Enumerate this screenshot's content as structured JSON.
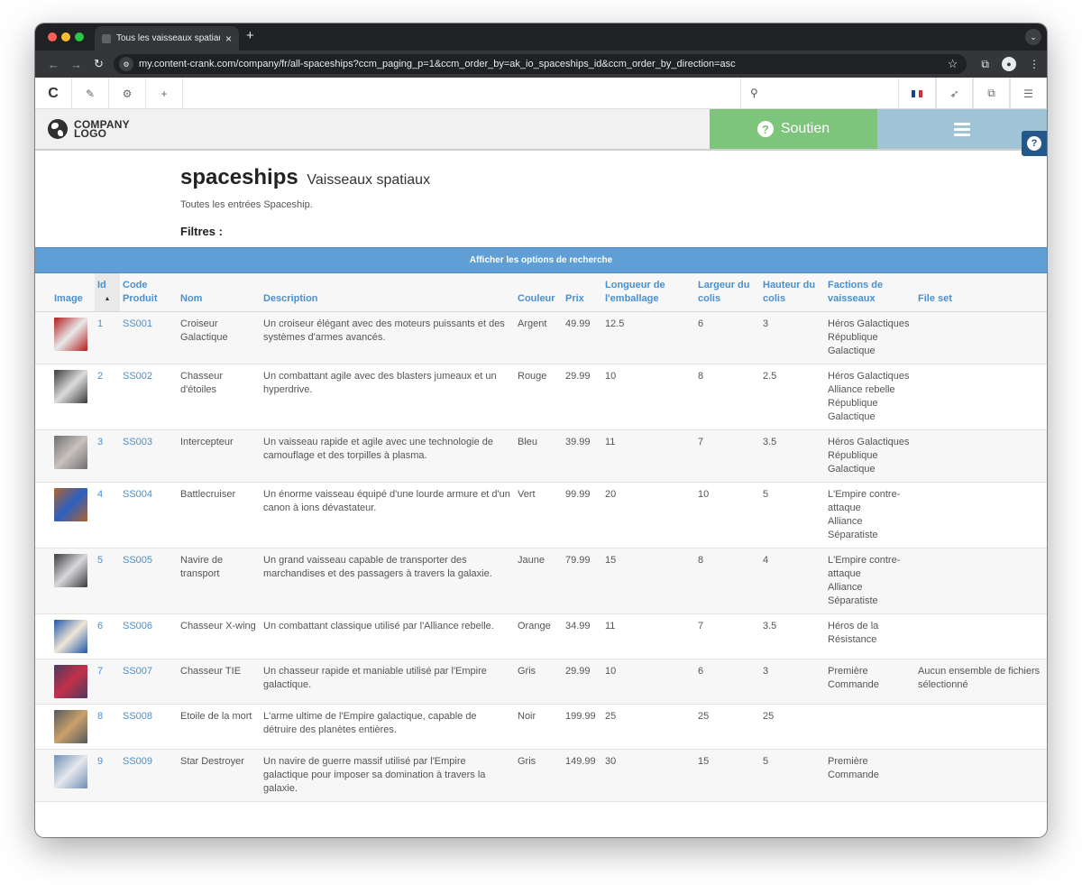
{
  "browser": {
    "tab_title": "Tous les vaisseaux spatiaux :",
    "tab_close": "×",
    "new_tab": "+",
    "url": "my.content-crank.com/company/fr/all-spaceships?ccm_paging_p=1&ccm_order_by=ak_io_spaceships_id&ccm_order_by_direction=asc"
  },
  "cms": {
    "logo": "C"
  },
  "header": {
    "logo_line1": "COMPANY",
    "logo_line2": "LOGO",
    "support_label": "Soutien",
    "help_glyph": "?",
    "support_glyph": "?"
  },
  "page": {
    "title": "spaceships",
    "subtitle": "Vaisseaux spatiaux",
    "description": "Toutes les entrées Spaceship.",
    "filters_label": "Filtres :",
    "search_options_label": "Afficher les options de recherche"
  },
  "colors": {
    "accent": "#4a90d0",
    "support_green": "#7dc57a",
    "menu_blue": "#9fc4d6",
    "search_bar": "#5f9fd6",
    "help": "#24588a"
  },
  "table": {
    "headers": {
      "image": "Image",
      "id": "Id",
      "code": "Code Produit",
      "name": "Nom",
      "description": "Description",
      "color": "Couleur",
      "price": "Prix",
      "pkg_length_1": "Longueur de",
      "pkg_length_2": "l'emballage",
      "width_1": "Largeur du",
      "width_2": "colis",
      "height_1": "Hauteur du",
      "height_2": "colis",
      "factions_1": "Factions de",
      "factions_2": "vaisseaux",
      "fileset": "File set"
    },
    "rows": [
      {
        "id": "1",
        "code": "SS001",
        "name": "Croiseur Galactique",
        "description": "Un croiseur élégant avec des moteurs puissants et des systèmes d'armes avancés.",
        "color": "Argent",
        "price": "49.99",
        "length": "12.5",
        "width": "6",
        "height": "3",
        "factions": [
          "Héros Galactiques",
          "République Galactique"
        ],
        "fileset": "",
        "thumb_colors": [
          "#b11d1d",
          "#e9e9e9"
        ]
      },
      {
        "id": "2",
        "code": "SS002",
        "name": "Chasseur d'étoiles",
        "description": "Un combattant agile avec des blasters jumeaux et un hyperdrive.",
        "color": "Rouge",
        "price": "29.99",
        "length": "10",
        "width": "8",
        "height": "2.5",
        "factions": [
          "Héros Galactiques",
          "Alliance rebelle",
          "République Galactique"
        ],
        "fileset": "",
        "thumb_colors": [
          "#3a3a3a",
          "#dcdcdc"
        ]
      },
      {
        "id": "3",
        "code": "SS003",
        "name": "Intercepteur",
        "description": "Un vaisseau rapide et agile avec une technologie de camouflage et des torpilles à plasma.",
        "color": "Bleu",
        "price": "39.99",
        "length": "11",
        "width": "7",
        "height": "3.5",
        "factions": [
          "Héros Galactiques",
          "République Galactique"
        ],
        "fileset": "",
        "thumb_colors": [
          "#6f6f73",
          "#c9c2bd"
        ]
      },
      {
        "id": "4",
        "code": "SS004",
        "name": "Battlecruiser",
        "description": "Un énorme vaisseau équipé d'une lourde armure et d'un canon à ions dévastateur.",
        "color": "Vert",
        "price": "99.99",
        "length": "20",
        "width": "10",
        "height": "5",
        "factions": [
          "L'Empire contre-attaque",
          "Alliance Séparatiste"
        ],
        "fileset": "",
        "thumb_colors": [
          "#b0642d",
          "#2c5fc0"
        ]
      },
      {
        "id": "5",
        "code": "SS005",
        "name": "Navire de transport",
        "description": "Un grand vaisseau capable de transporter des marchandises et des passagers à travers la galaxie.",
        "color": "Jaune",
        "price": "79.99",
        "length": "15",
        "width": "8",
        "height": "4",
        "factions": [
          "L'Empire contre-attaque",
          "Alliance Séparatiste"
        ],
        "fileset": "",
        "thumb_colors": [
          "#3b3b3e",
          "#d8d8da"
        ]
      },
      {
        "id": "6",
        "code": "SS006",
        "name": "Chasseur X-wing",
        "description": "Un combattant classique utilisé par l'Alliance rebelle.",
        "color": "Orange",
        "price": "34.99",
        "length": "11",
        "width": "7",
        "height": "3.5",
        "factions": [
          "Héros de la Résistance"
        ],
        "fileset": "",
        "thumb_colors": [
          "#1f56a8",
          "#f0e6d8"
        ]
      },
      {
        "id": "7",
        "code": "SS007",
        "name": "Chasseur TIE",
        "description": "Un chasseur rapide et maniable utilisé par l'Empire galactique.",
        "color": "Gris",
        "price": "29.99",
        "length": "10",
        "width": "6",
        "height": "3",
        "factions": [
          "Première Commande"
        ],
        "fileset": "Aucun ensemble de fichiers sélectionné",
        "thumb_colors": [
          "#4a3b5e",
          "#c4304a"
        ]
      },
      {
        "id": "8",
        "code": "SS008",
        "name": "Etoile de la mort",
        "description": "L'arme ultime de l'Empire galactique, capable de détruire des planètes entières.",
        "color": "Noir",
        "price": "199.99",
        "length": "25",
        "width": "25",
        "height": "25",
        "factions": [],
        "fileset": "",
        "thumb_colors": [
          "#55585e",
          "#c9a26a"
        ]
      },
      {
        "id": "9",
        "code": "SS009",
        "name": "Star Destroyer",
        "description": "Un navire de guerre massif utilisé par l'Empire galactique pour imposer sa domination à travers la galaxie.",
        "color": "Gris",
        "price": "149.99",
        "length": "30",
        "width": "15",
        "height": "5",
        "factions": [
          "Première Commande"
        ],
        "fileset": "",
        "thumb_colors": [
          "#6f8fb5",
          "#e6e8ec"
        ]
      }
    ]
  }
}
